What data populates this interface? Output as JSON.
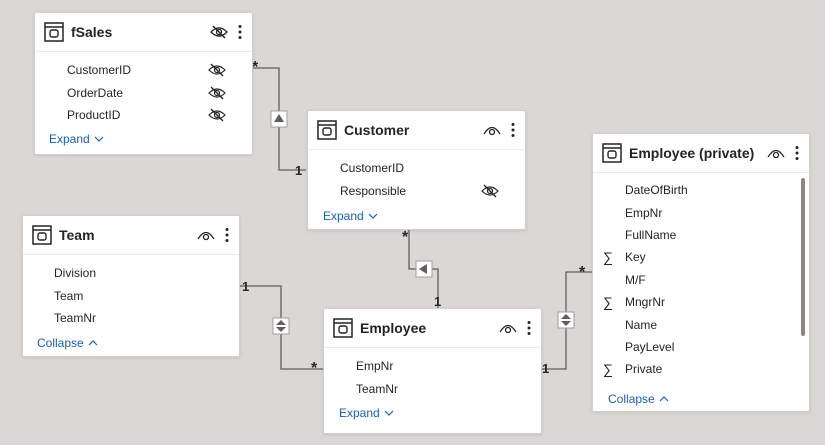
{
  "tables": {
    "fsales": {
      "title": "fSales",
      "fields": [
        {
          "name": "CustomerID",
          "hidden": true
        },
        {
          "name": "OrderDate",
          "hidden": true
        },
        {
          "name": "ProductID",
          "hidden": true
        }
      ],
      "toggle_label": "Expand",
      "header_icon": "eye-hidden-icon"
    },
    "customer": {
      "title": "Customer",
      "fields": [
        {
          "name": "CustomerID",
          "hidden": false
        },
        {
          "name": "Responsible",
          "hidden": true
        }
      ],
      "toggle_label": "Expand",
      "header_icon": "eye-icon"
    },
    "team": {
      "title": "Team",
      "fields": [
        {
          "name": "Division"
        },
        {
          "name": "Team"
        },
        {
          "name": "TeamNr"
        }
      ],
      "toggle_label": "Collapse",
      "header_icon": "eye-icon"
    },
    "employee": {
      "title": "Employee",
      "fields": [
        {
          "name": "EmpNr"
        },
        {
          "name": "TeamNr"
        }
      ],
      "toggle_label": "Expand",
      "header_icon": "eye-icon"
    },
    "employee_private": {
      "title": "Employee (private)",
      "fields": [
        {
          "name": "DateOfBirth",
          "sigma": false
        },
        {
          "name": "EmpNr",
          "sigma": false
        },
        {
          "name": "FullName",
          "sigma": false
        },
        {
          "name": "Key",
          "sigma": true
        },
        {
          "name": "M/F",
          "sigma": false
        },
        {
          "name": "MngrNr",
          "sigma": true
        },
        {
          "name": "Name",
          "sigma": false
        },
        {
          "name": "PayLevel",
          "sigma": false
        },
        {
          "name": "Private",
          "sigma": true
        }
      ],
      "toggle_label": "Collapse",
      "header_icon": "eye-icon"
    }
  },
  "relationships": {
    "fsales_customer": {
      "from": "fSales",
      "to": "Customer",
      "many": "*",
      "one": "1",
      "filter": "single"
    },
    "customer_employee": {
      "from": "Customer",
      "to": "Employee",
      "many": "*",
      "one": "1",
      "filter": "single"
    },
    "team_employee": {
      "from": "Team",
      "to": "Employee",
      "many": "*",
      "one": "1",
      "filter": "both"
    },
    "employee_private": {
      "from": "Employee",
      "to": "Employee (private)",
      "many": "*",
      "one": "1",
      "filter": "both"
    }
  },
  "colors": {
    "canvas": "#dad7d4",
    "card": "#ffffff",
    "line": "#605e5c",
    "link": "#1a5fb4",
    "text": "#252423"
  },
  "sigma_symbol": "∑"
}
